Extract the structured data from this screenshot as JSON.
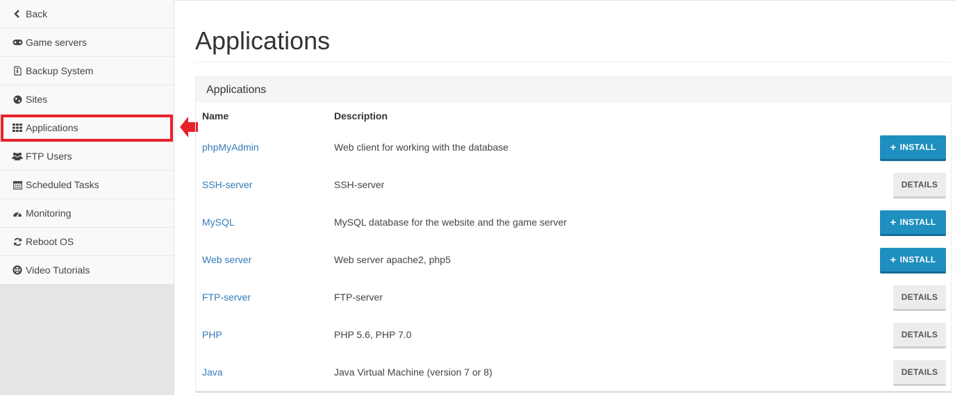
{
  "sidebar": {
    "items": [
      {
        "label": "Back",
        "icon": "chevron-left-icon"
      },
      {
        "label": "Game servers",
        "icon": "gamepad-icon"
      },
      {
        "label": "Backup System",
        "icon": "file-archive-icon"
      },
      {
        "label": "Sites",
        "icon": "globe-icon"
      },
      {
        "label": "Applications",
        "icon": "grid-icon"
      },
      {
        "label": "FTP Users",
        "icon": "users-icon"
      },
      {
        "label": "Scheduled Tasks",
        "icon": "calendar-icon"
      },
      {
        "label": "Monitoring",
        "icon": "dashboard-icon"
      },
      {
        "label": "Reboot OS",
        "icon": "refresh-icon"
      },
      {
        "label": "Video Tutorials",
        "icon": "lifebuoy-icon"
      }
    ]
  },
  "main": {
    "title": "Applications",
    "panel": {
      "heading": "Applications",
      "columns": {
        "name": "Name",
        "description": "Description"
      },
      "rows": [
        {
          "name": "phpMyAdmin",
          "description": "Web client for working with the database",
          "action": "INSTALL"
        },
        {
          "name": "SSH-server",
          "description": "SSH-server",
          "action": "DETAILS"
        },
        {
          "name": "MySQL",
          "description": "MySQL database for the website and the game server",
          "action": "INSTALL"
        },
        {
          "name": "Web server",
          "description": "Web server apache2, php5",
          "action": "INSTALL"
        },
        {
          "name": "FTP-server",
          "description": "FTP-server",
          "action": "DETAILS"
        },
        {
          "name": "PHP",
          "description": "PHP 5.6, PHP 7.0",
          "action": "DETAILS"
        },
        {
          "name": "Java",
          "description": "Java Virtual Machine (version 7 or 8)",
          "action": "DETAILS"
        }
      ]
    }
  },
  "colors": {
    "accent": "#1f8fc0",
    "link": "#337ab7",
    "highlight": "#e8222a"
  }
}
